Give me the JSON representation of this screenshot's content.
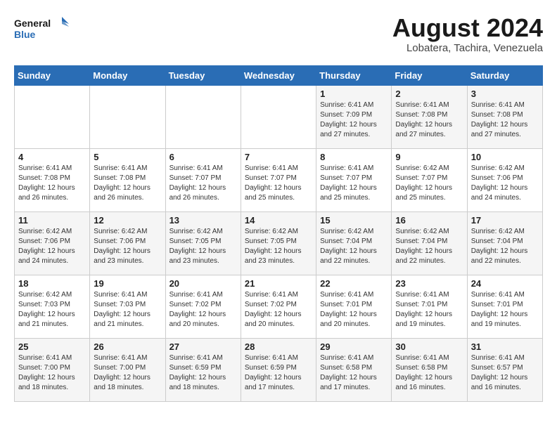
{
  "header": {
    "logo_line1": "General",
    "logo_line2": "Blue",
    "month_title": "August 2024",
    "location": "Lobatera, Tachira, Venezuela"
  },
  "weekdays": [
    "Sunday",
    "Monday",
    "Tuesday",
    "Wednesday",
    "Thursday",
    "Friday",
    "Saturday"
  ],
  "weeks": [
    [
      {
        "day": "",
        "info": ""
      },
      {
        "day": "",
        "info": ""
      },
      {
        "day": "",
        "info": ""
      },
      {
        "day": "",
        "info": ""
      },
      {
        "day": "1",
        "info": "Sunrise: 6:41 AM\nSunset: 7:09 PM\nDaylight: 12 hours\nand 27 minutes."
      },
      {
        "day": "2",
        "info": "Sunrise: 6:41 AM\nSunset: 7:08 PM\nDaylight: 12 hours\nand 27 minutes."
      },
      {
        "day": "3",
        "info": "Sunrise: 6:41 AM\nSunset: 7:08 PM\nDaylight: 12 hours\nand 27 minutes."
      }
    ],
    [
      {
        "day": "4",
        "info": "Sunrise: 6:41 AM\nSunset: 7:08 PM\nDaylight: 12 hours\nand 26 minutes."
      },
      {
        "day": "5",
        "info": "Sunrise: 6:41 AM\nSunset: 7:08 PM\nDaylight: 12 hours\nand 26 minutes."
      },
      {
        "day": "6",
        "info": "Sunrise: 6:41 AM\nSunset: 7:07 PM\nDaylight: 12 hours\nand 26 minutes."
      },
      {
        "day": "7",
        "info": "Sunrise: 6:41 AM\nSunset: 7:07 PM\nDaylight: 12 hours\nand 25 minutes."
      },
      {
        "day": "8",
        "info": "Sunrise: 6:41 AM\nSunset: 7:07 PM\nDaylight: 12 hours\nand 25 minutes."
      },
      {
        "day": "9",
        "info": "Sunrise: 6:42 AM\nSunset: 7:07 PM\nDaylight: 12 hours\nand 25 minutes."
      },
      {
        "day": "10",
        "info": "Sunrise: 6:42 AM\nSunset: 7:06 PM\nDaylight: 12 hours\nand 24 minutes."
      }
    ],
    [
      {
        "day": "11",
        "info": "Sunrise: 6:42 AM\nSunset: 7:06 PM\nDaylight: 12 hours\nand 24 minutes."
      },
      {
        "day": "12",
        "info": "Sunrise: 6:42 AM\nSunset: 7:06 PM\nDaylight: 12 hours\nand 23 minutes."
      },
      {
        "day": "13",
        "info": "Sunrise: 6:42 AM\nSunset: 7:05 PM\nDaylight: 12 hours\nand 23 minutes."
      },
      {
        "day": "14",
        "info": "Sunrise: 6:42 AM\nSunset: 7:05 PM\nDaylight: 12 hours\nand 23 minutes."
      },
      {
        "day": "15",
        "info": "Sunrise: 6:42 AM\nSunset: 7:04 PM\nDaylight: 12 hours\nand 22 minutes."
      },
      {
        "day": "16",
        "info": "Sunrise: 6:42 AM\nSunset: 7:04 PM\nDaylight: 12 hours\nand 22 minutes."
      },
      {
        "day": "17",
        "info": "Sunrise: 6:42 AM\nSunset: 7:04 PM\nDaylight: 12 hours\nand 22 minutes."
      }
    ],
    [
      {
        "day": "18",
        "info": "Sunrise: 6:42 AM\nSunset: 7:03 PM\nDaylight: 12 hours\nand 21 minutes."
      },
      {
        "day": "19",
        "info": "Sunrise: 6:41 AM\nSunset: 7:03 PM\nDaylight: 12 hours\nand 21 minutes."
      },
      {
        "day": "20",
        "info": "Sunrise: 6:41 AM\nSunset: 7:02 PM\nDaylight: 12 hours\nand 20 minutes."
      },
      {
        "day": "21",
        "info": "Sunrise: 6:41 AM\nSunset: 7:02 PM\nDaylight: 12 hours\nand 20 minutes."
      },
      {
        "day": "22",
        "info": "Sunrise: 6:41 AM\nSunset: 7:01 PM\nDaylight: 12 hours\nand 20 minutes."
      },
      {
        "day": "23",
        "info": "Sunrise: 6:41 AM\nSunset: 7:01 PM\nDaylight: 12 hours\nand 19 minutes."
      },
      {
        "day": "24",
        "info": "Sunrise: 6:41 AM\nSunset: 7:01 PM\nDaylight: 12 hours\nand 19 minutes."
      }
    ],
    [
      {
        "day": "25",
        "info": "Sunrise: 6:41 AM\nSunset: 7:00 PM\nDaylight: 12 hours\nand 18 minutes."
      },
      {
        "day": "26",
        "info": "Sunrise: 6:41 AM\nSunset: 7:00 PM\nDaylight: 12 hours\nand 18 minutes."
      },
      {
        "day": "27",
        "info": "Sunrise: 6:41 AM\nSunset: 6:59 PM\nDaylight: 12 hours\nand 18 minutes."
      },
      {
        "day": "28",
        "info": "Sunrise: 6:41 AM\nSunset: 6:59 PM\nDaylight: 12 hours\nand 17 minutes."
      },
      {
        "day": "29",
        "info": "Sunrise: 6:41 AM\nSunset: 6:58 PM\nDaylight: 12 hours\nand 17 minutes."
      },
      {
        "day": "30",
        "info": "Sunrise: 6:41 AM\nSunset: 6:58 PM\nDaylight: 12 hours\nand 16 minutes."
      },
      {
        "day": "31",
        "info": "Sunrise: 6:41 AM\nSunset: 6:57 PM\nDaylight: 12 hours\nand 16 minutes."
      }
    ]
  ]
}
